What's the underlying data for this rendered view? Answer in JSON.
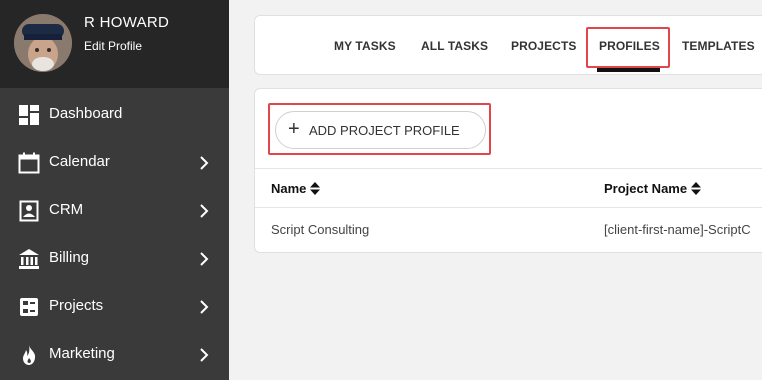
{
  "user": {
    "name": "R HOWARD",
    "edit_label": "Edit Profile"
  },
  "sidebar": {
    "items": [
      {
        "label": "Dashboard",
        "icon": "dashboard-icon",
        "has_chevron": false
      },
      {
        "label": "Calendar",
        "icon": "calendar-icon",
        "has_chevron": true
      },
      {
        "label": "CRM",
        "icon": "contact-icon",
        "has_chevron": true
      },
      {
        "label": "Billing",
        "icon": "bank-icon",
        "has_chevron": true
      },
      {
        "label": "Projects",
        "icon": "projects-icon",
        "has_chevron": true
      },
      {
        "label": "Marketing",
        "icon": "flame-icon",
        "has_chevron": true
      }
    ]
  },
  "tabs": [
    {
      "label": "MY TASKS"
    },
    {
      "label": "ALL TASKS"
    },
    {
      "label": "PROJECTS"
    },
    {
      "label": "PROFILES",
      "active": true
    },
    {
      "label": "TEMPLATES"
    }
  ],
  "add_button": {
    "label": "ADD PROJECT PROFILE"
  },
  "table": {
    "columns": [
      "Name",
      "Project Name"
    ],
    "rows": [
      [
        "Script Consulting",
        "[client-first-name]-ScriptC"
      ]
    ]
  },
  "colors": {
    "sidebar_bg": "#3a3a3a",
    "profile_bg": "#262626",
    "highlight": "#e0474c",
    "active_underline": "#111111"
  }
}
